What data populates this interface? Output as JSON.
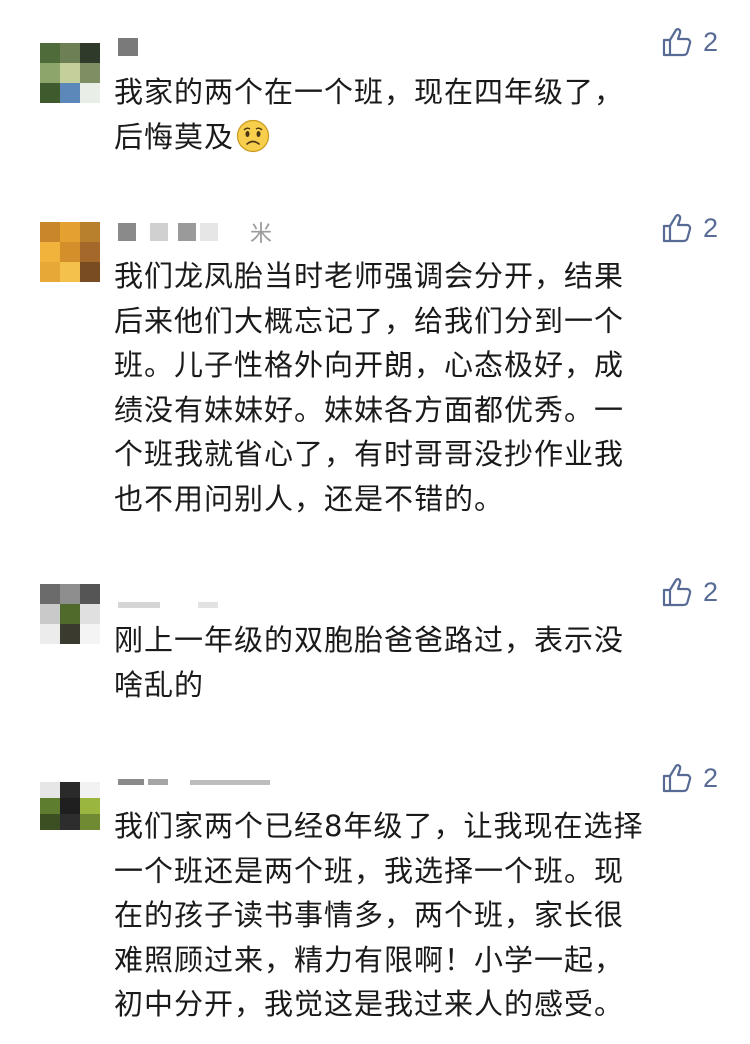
{
  "comments": [
    {
      "name_suffix": "",
      "likes": "2",
      "lines": [
        "我家的两个在一个班，现在四年级了，",
        "后悔莫及"
      ],
      "emoji": "sad-face-icon"
    },
    {
      "name_suffix": "米",
      "likes": "2",
      "lines": [
        "我们龙凤胎当时老师强调会分开，结果",
        "后来他们大概忘记了，给我们分到一个",
        "班。儿子性格外向开朗，心态极好，成",
        "绩没有妹妹好。妹妹各方面都优秀。一",
        "个班我就省心了，有时哥哥没抄作业我",
        "也不用问别人，还是不错的。"
      ]
    },
    {
      "name_suffix": "",
      "likes": "2",
      "lines": [
        "刚上一年级的双胞胎爸爸路过，表示没",
        "啥乱的"
      ]
    },
    {
      "name_suffix": "",
      "likes": "2",
      "lines": [
        "我们家两个已经8年级了，让我现在选择",
        "一个班还是两个班，我选择一个班。现",
        "在的孩子读书事情多，两个班，家长很",
        "难照顾过来，精力有限啊！小学一起，",
        "初中分开，我觉这是我过来人的感受。"
      ]
    }
  ],
  "colors": {
    "like_blue": "#576b95",
    "text": "#1a1a1a"
  }
}
